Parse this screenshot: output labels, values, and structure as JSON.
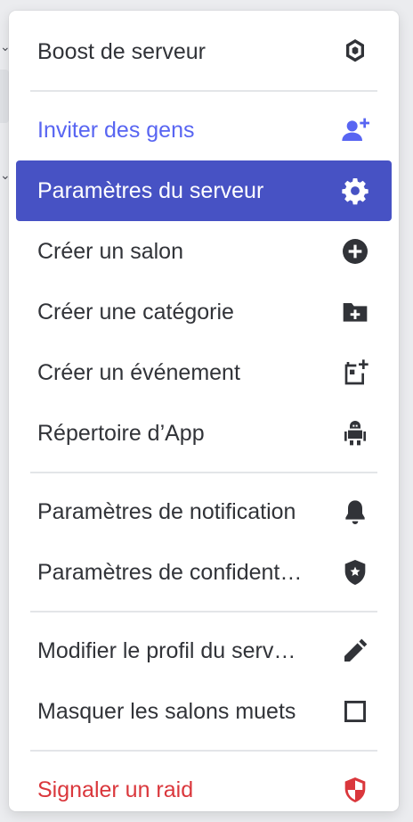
{
  "menu": {
    "items": [
      {
        "label": "Boost de serveur",
        "icon": "boost-icon"
      },
      {
        "label": "Inviter des gens",
        "icon": "add-user-icon",
        "color": "#5865f2"
      },
      {
        "label": "Paramètres du serveur",
        "icon": "gear-icon",
        "state": "hovered",
        "color": "#4752c4"
      },
      {
        "label": "Créer un salon",
        "icon": "plus-circle-icon"
      },
      {
        "label": "Créer une catégorie",
        "icon": "folder-plus-icon"
      },
      {
        "label": "Créer un événement",
        "icon": "calendar-plus-icon"
      },
      {
        "label": "Répertoire d’App",
        "icon": "robot-icon"
      },
      {
        "label": "Paramètres de notification",
        "icon": "bell-icon"
      },
      {
        "label": "Paramètres de confident…",
        "icon": "shield-star-icon"
      },
      {
        "label": "Modifier le profil du serv…",
        "icon": "pencil-icon"
      },
      {
        "label": "Masquer les salons muets",
        "icon": "checkbox-icon",
        "checked": false
      },
      {
        "label": "Signaler un raid",
        "icon": "shield-alert-icon",
        "color": "#da373c"
      }
    ]
  }
}
